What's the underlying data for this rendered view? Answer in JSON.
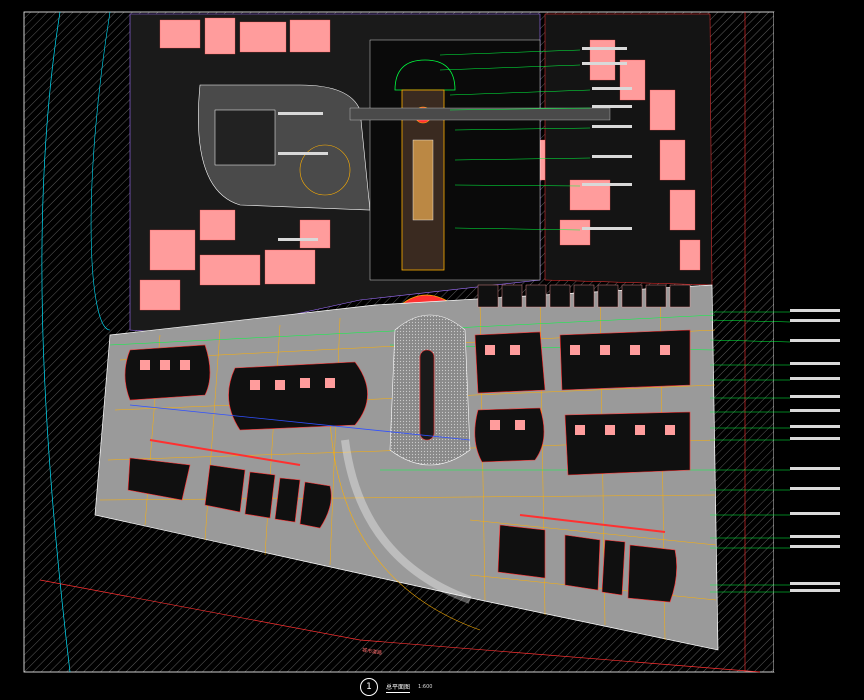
{
  "viewer": {
    "background": "#000000",
    "drawing_border_color": "#ffffff"
  },
  "title_block": {
    "number": "1",
    "title": "总平面图",
    "scale": "1:600"
  },
  "road_label": "城市道路",
  "colors": {
    "hatch": "#5c5c5c",
    "site_plaza": "#9a9a9a",
    "building": "#ff9c9c",
    "grid_lines": "#ffb000",
    "green_lines": "#00ff40",
    "cyan_lines": "#00e5ff",
    "purple_lines": "#a070ff",
    "red_lines": "#ff3030",
    "dark_parcel": "#101010"
  }
}
